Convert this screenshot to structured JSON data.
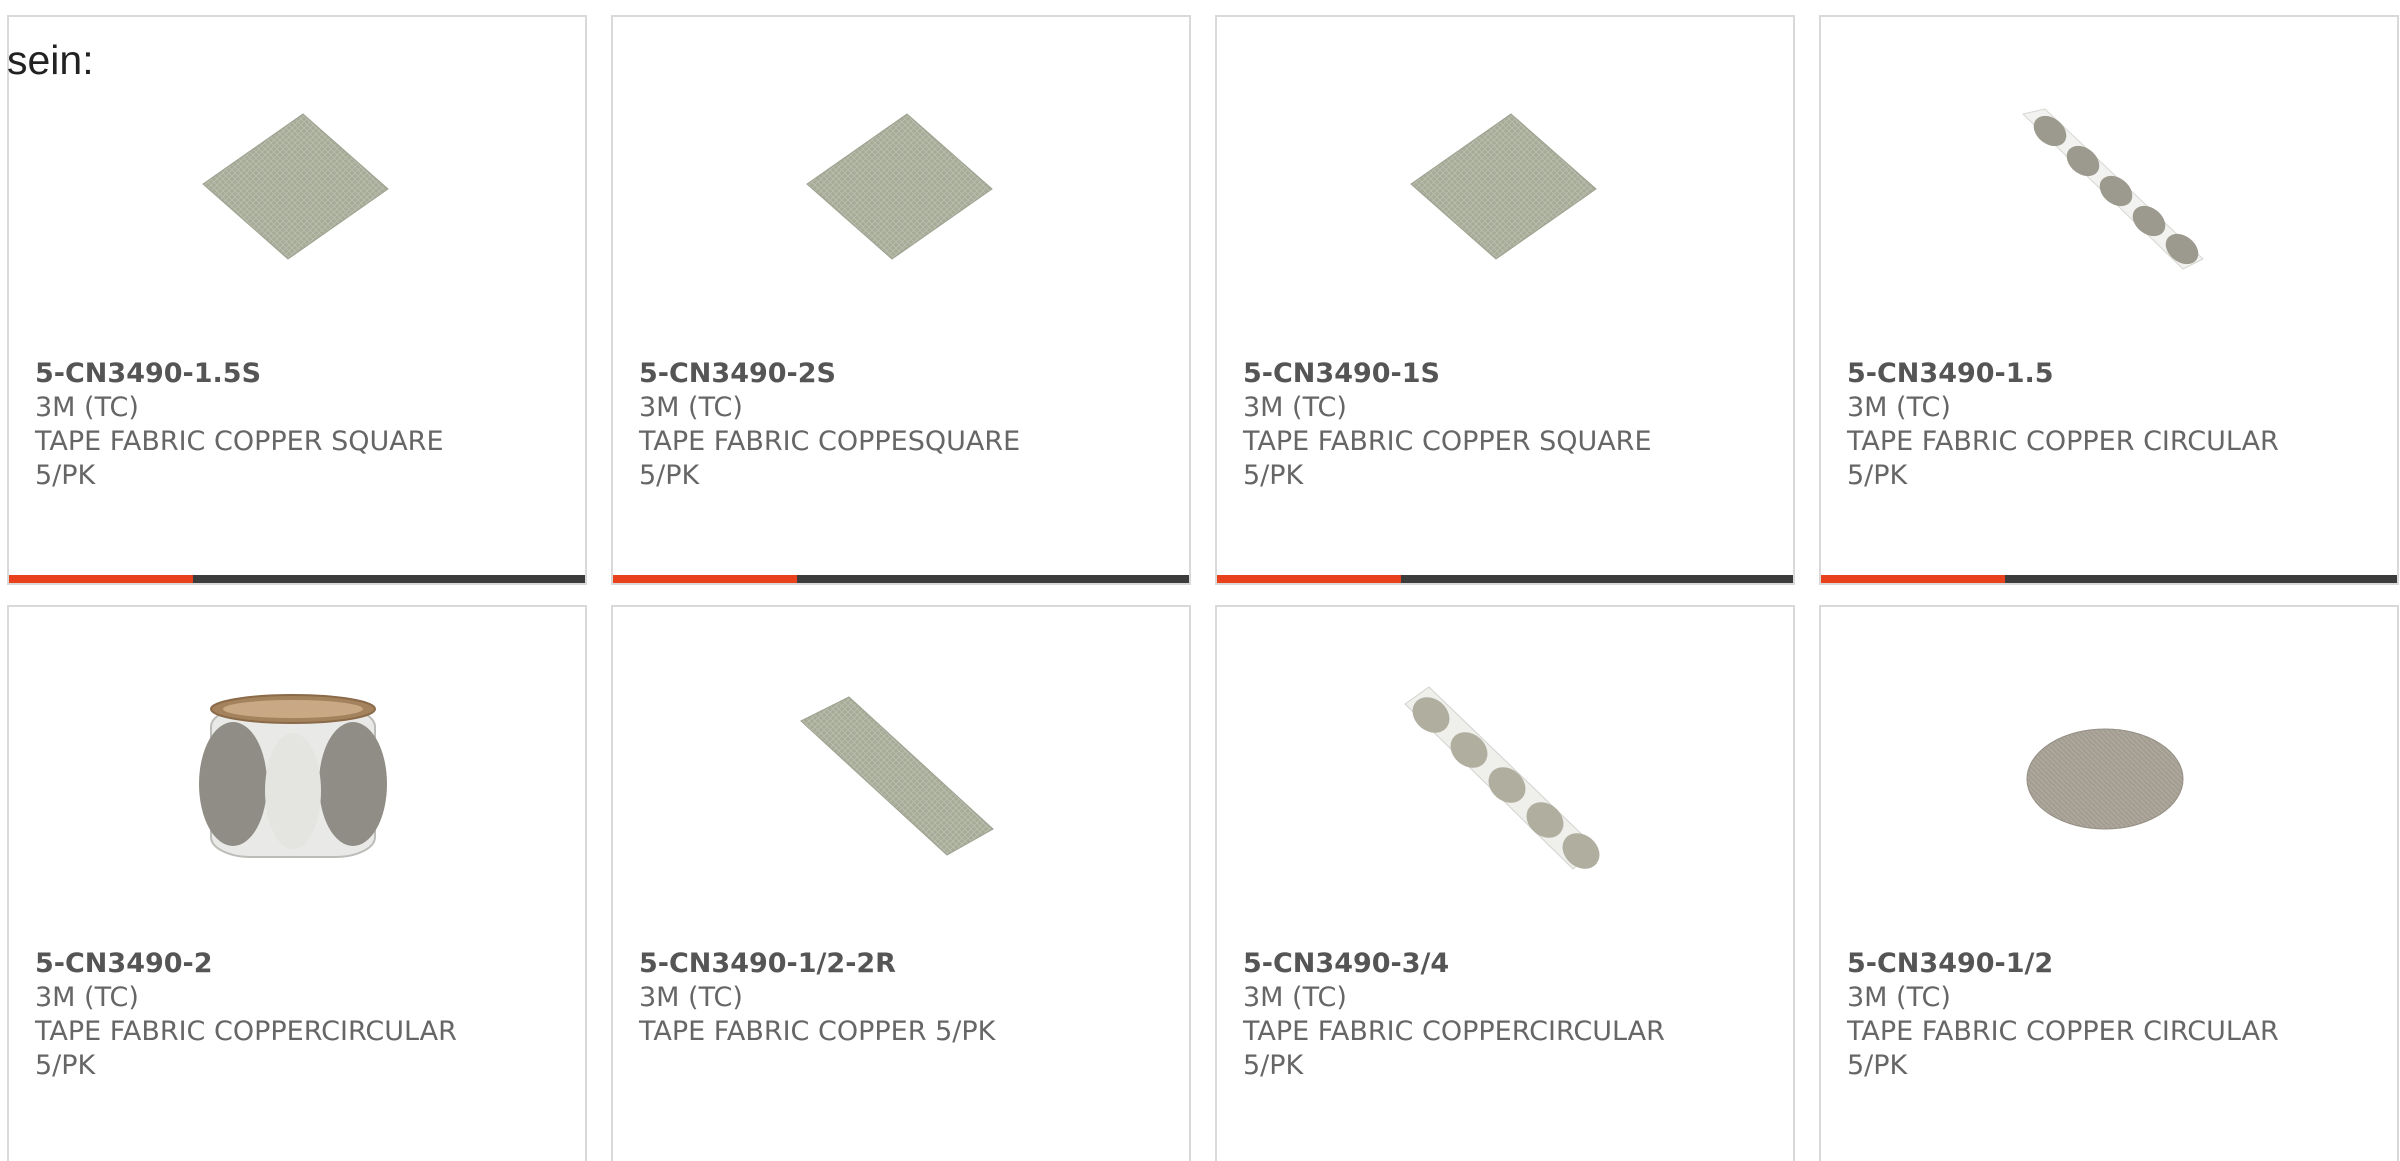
{
  "heading": "sein:",
  "colors": {
    "accent": "#e8411b",
    "track": "#3c3c3c",
    "border": "#d9d9d9",
    "text": "#666666"
  },
  "products": [
    {
      "part": "5-CN3490-1.5S",
      "brand": "3M (TC)",
      "desc": "TAPE FABRIC COPPER SQUARE",
      "pack": "5/PK",
      "image": "copper-square-sheet",
      "progress": 0.32
    },
    {
      "part": "5-CN3490-2S",
      "brand": "3M (TC)",
      "desc": "TAPE FABRIC COPPESQUARE",
      "pack": "5/PK",
      "image": "copper-square-sheet",
      "progress": 0.32
    },
    {
      "part": "5-CN3490-1S",
      "brand": "3M (TC)",
      "desc": "TAPE FABRIC COPPER SQUARE",
      "pack": "5/PK",
      "image": "copper-square-sheet",
      "progress": 0.32
    },
    {
      "part": "5-CN3490-1.5",
      "brand": "3M (TC)",
      "desc": "TAPE FABRIC COPPER CIRCULAR",
      "pack": "5/PK",
      "image": "circle-dots-strip",
      "progress": 0.32
    },
    {
      "part": "5-CN3490-2",
      "brand": "3M (TC)",
      "desc": "TAPE FABRIC COPPERCIRCULAR",
      "pack": "5/PK",
      "image": "tape-roll",
      "progress": null
    },
    {
      "part": "5-CN3490-1/2-2R",
      "brand": "3M (TC)",
      "desc": "TAPE FABRIC COPPER 5/PK",
      "pack": "",
      "image": "copper-strip",
      "progress": null
    },
    {
      "part": "5-CN3490-3/4",
      "brand": "3M (TC)",
      "desc": "TAPE FABRIC COPPERCIRCULAR",
      "pack": "5/PK",
      "image": "circle-dots-strip",
      "progress": null
    },
    {
      "part": "5-CN3490-1/2",
      "brand": "3M (TC)",
      "desc": "TAPE FABRIC COPPER CIRCULAR",
      "pack": "5/PK",
      "image": "copper-disc",
      "progress": null
    }
  ]
}
